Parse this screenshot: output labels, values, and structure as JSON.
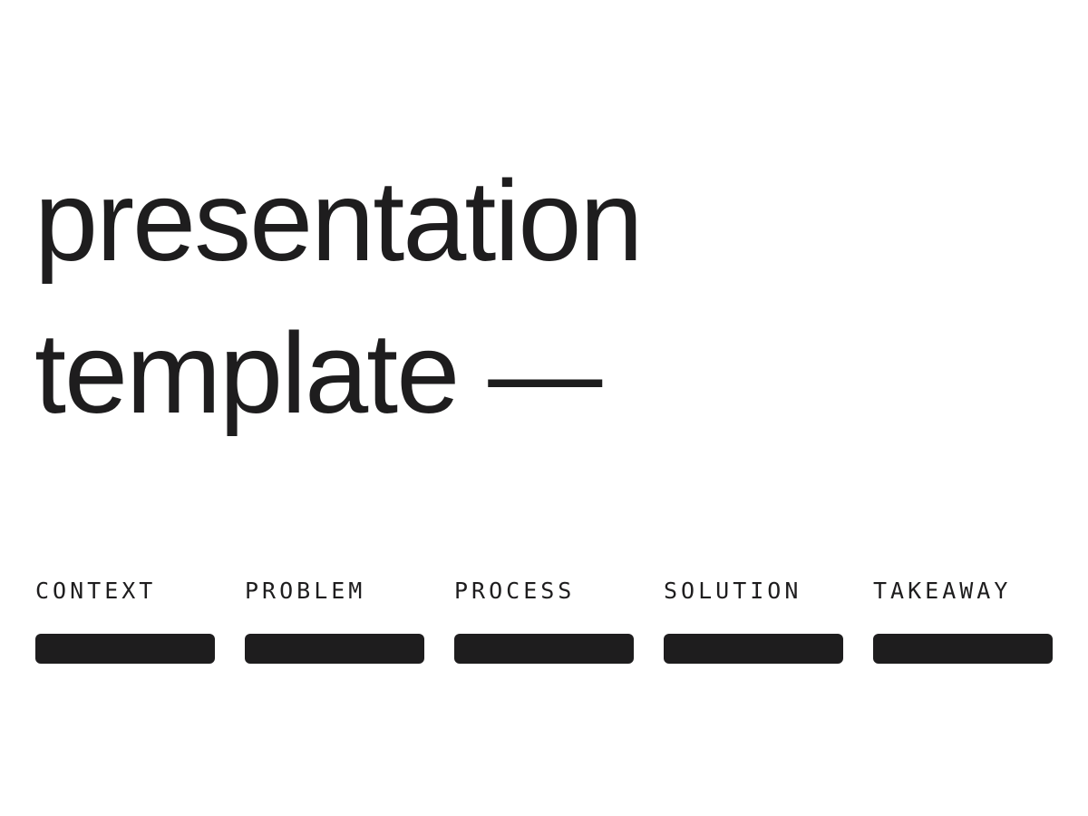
{
  "title": {
    "line1": "presentation",
    "line2": "template —"
  },
  "sections": [
    {
      "label": "CONTEXT"
    },
    {
      "label": "PROBLEM"
    },
    {
      "label": "PROCESS"
    },
    {
      "label": "SOLUTION"
    },
    {
      "label": "TAKEAWAY"
    }
  ],
  "colors": {
    "background": "#ffffff",
    "ink": "#1e1d1e"
  }
}
